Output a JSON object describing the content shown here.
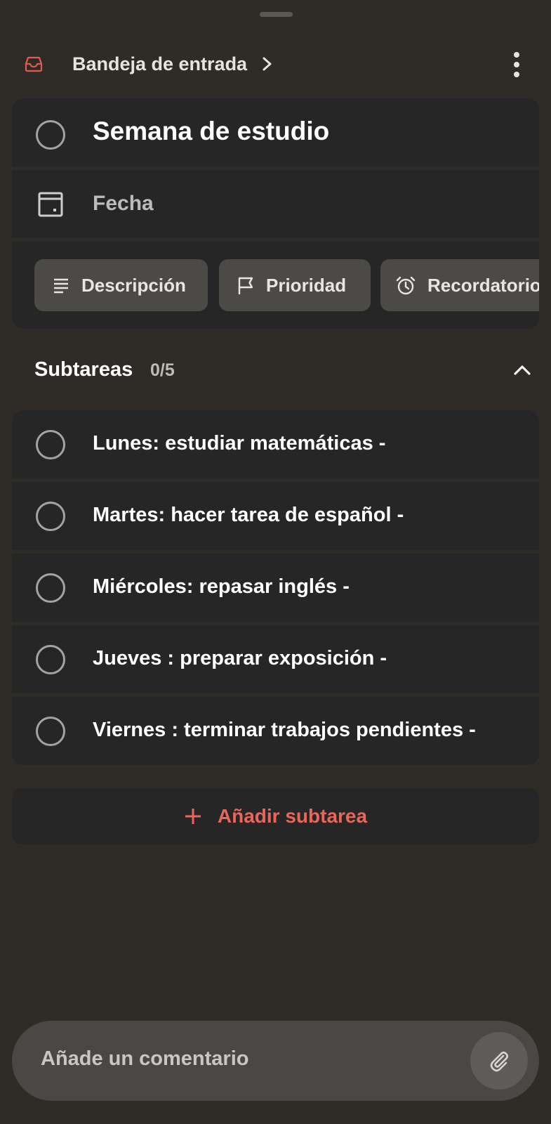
{
  "header": {
    "inbox_icon": "inbox-icon",
    "project_label": "Bandeja de entrada",
    "more_icon": "more-vertical-icon",
    "accent_color": "#e05a4f"
  },
  "task": {
    "title": "Semana de estudio",
    "completed": false,
    "date_label": "Fecha"
  },
  "actions": {
    "description_label": "Descripción",
    "priority_label": "Prioridad",
    "reminder_label": "Recordatorios"
  },
  "subtasks": {
    "label": "Subtareas",
    "count": "0/5",
    "items": [
      {
        "text": "Lunes: estudiar matemáticas -",
        "completed": false
      },
      {
        "text": "Martes: hacer tarea de español -",
        "completed": false
      },
      {
        "text": "Miércoles: repasar inglés -",
        "completed": false
      },
      {
        "text": "Jueves : preparar exposición -",
        "completed": false
      },
      {
        "text": "Viernes : terminar trabajos pendientes -",
        "completed": false
      }
    ],
    "add_label": "Añadir subtarea",
    "add_color": "#e8665a"
  },
  "comment": {
    "placeholder": "Añade un comentario",
    "attach_icon": "paperclip-icon"
  }
}
